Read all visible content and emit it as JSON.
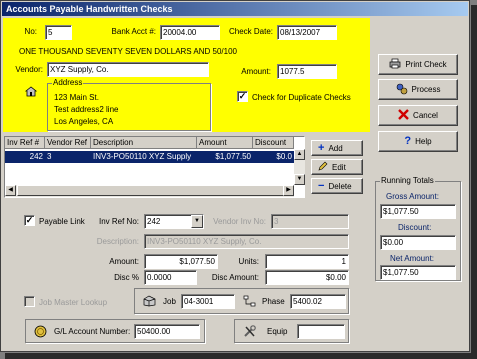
{
  "window": {
    "title": "Accounts Payable Handwritten Checks"
  },
  "check": {
    "no_label": "No:",
    "no_value": "5",
    "bank_label": "Bank Acct #:",
    "bank_value": "20004.00",
    "date_label": "Check Date:",
    "date_value": "08/13/2007",
    "amount_words": "ONE THOUSAND SEVENTY SEVEN DOLLARS AND 50/100",
    "vendor_label": "Vendor:",
    "vendor_value": "XYZ Supply, Co.",
    "amount_label": "Amount:",
    "amount_value": "1077.5",
    "address_label": "Address",
    "address_lines": [
      "123 Main St.",
      "Test address2 line",
      "Los Angeles, CA"
    ],
    "dup_check_label": "Check for Duplicate Checks",
    "dup_check_checked": "✓"
  },
  "actions": {
    "print": "Print Check",
    "process": "Process",
    "cancel": "Cancel",
    "help": "Help"
  },
  "grid": {
    "columns": [
      "Inv Ref #",
      "Vendor Ref",
      "Description",
      "Amount",
      "Discount"
    ],
    "rows": [
      {
        "inv_ref": "242",
        "vendor_ref": "3",
        "description": "INV3-PO50110 XYZ Supply",
        "amount": "$1,077.50",
        "discount": "$0.0"
      }
    ]
  },
  "grid_actions": {
    "add": "Add",
    "edit": "Edit",
    "delete": "Delete"
  },
  "totals": {
    "title": "Running Totals",
    "gross_label": "Gross Amount:",
    "gross_value": "$1,077.50",
    "discount_label": "Discount:",
    "discount_value": "$0.00",
    "net_label": "Net Amount:",
    "net_value": "$1,077.50"
  },
  "detail": {
    "payable_link_label": "Payable Link",
    "payable_link_checked": "✓",
    "inv_ref_label": "Inv Ref No:",
    "inv_ref_value": "242",
    "vendor_inv_label": "Vendor Inv No:",
    "vendor_inv_value": "3",
    "description_label": "Description:",
    "description_value": "INV3-PO50110 XYZ Supply, Co.",
    "amount_label": "Amount:",
    "amount_value": "$1,077.50",
    "units_label": "Units:",
    "units_value": "1",
    "disc_pct_label": "Disc %",
    "disc_pct_value": "0.0000",
    "disc_amount_label": "Disc Amount:",
    "disc_amount_value": "$0.00",
    "job_master_label": "Job Master Lookup",
    "job_label": "Job",
    "job_value": "04-3001",
    "phase_label": "Phase",
    "phase_value": "5400.02",
    "gl_label": "G/L Account Number:",
    "gl_value": "50400.00",
    "equip_label": "Equip",
    "equip_value": ""
  },
  "icons": {
    "address": "house-icon",
    "print": "printer-icon",
    "process": "gears-icon",
    "cancel": "red-x-icon",
    "help": "question-icon",
    "add": "plus-icon",
    "edit": "pencil-icon",
    "delete": "minus-icon",
    "job": "crate-icon",
    "phase": "hierarchy-icon",
    "gl": "coin-icon",
    "equip": "tools-icon"
  },
  "colors": {
    "highlight": "#ffff00",
    "selection": "#0a246a",
    "title_start": "#0a246a",
    "title_end": "#a6caf0"
  }
}
